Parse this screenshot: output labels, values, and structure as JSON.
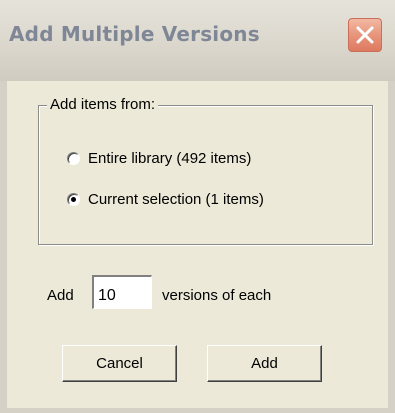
{
  "window": {
    "title": "Add Multiple Versions",
    "close_icon": "close-x-icon"
  },
  "group": {
    "legend": "Add items from:",
    "options": [
      {
        "label": "Entire library (492 items)",
        "checked": false
      },
      {
        "label": "Current selection (1 items)",
        "checked": true
      }
    ]
  },
  "count": {
    "prefix": "Add",
    "value": "10",
    "suffix": "versions of each"
  },
  "buttons": {
    "cancel": "Cancel",
    "add": "Add"
  },
  "colors": {
    "dialog_bg": "#ece9d8",
    "title_text": "#7f8796",
    "close_button": "#e8957c"
  }
}
